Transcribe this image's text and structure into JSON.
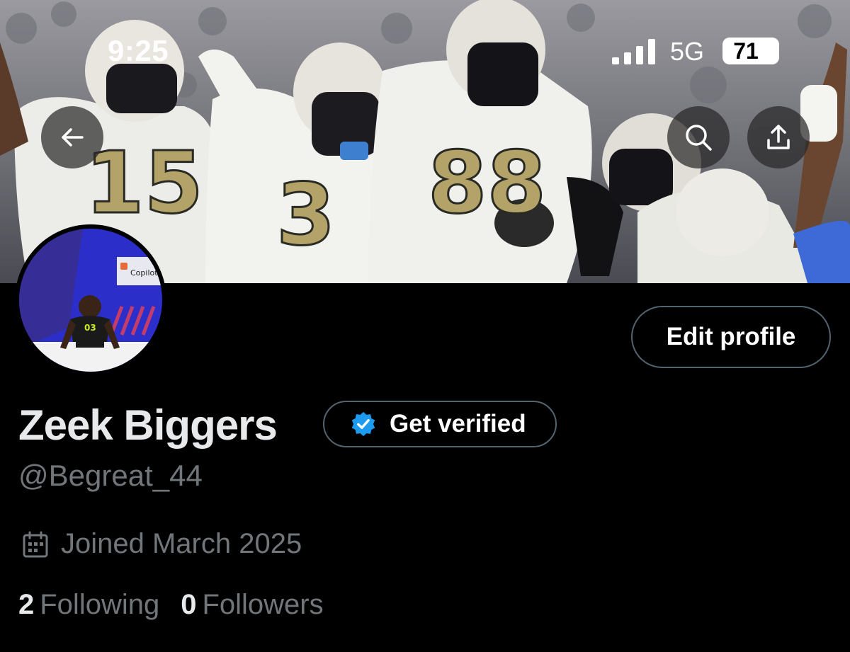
{
  "status_bar": {
    "time": "9:25",
    "network": "5G",
    "battery": "71"
  },
  "banner": {
    "jersey_numbers": [
      "15",
      "3",
      "88"
    ]
  },
  "header_actions": {
    "back_icon": "back-arrow-icon",
    "search_icon": "search-icon",
    "share_icon": "share-icon"
  },
  "avatar": {
    "jersey": "03",
    "sponsor_text": "Copilot"
  },
  "profile": {
    "edit_label": "Edit profile",
    "name": "Zeek Biggers",
    "get_verified_label": "Get verified",
    "handle": "@Begreat_44",
    "joined": "Joined March 2025",
    "following_count": "2",
    "following_label": "Following",
    "followers_count": "0",
    "followers_label": "Followers"
  },
  "colors": {
    "background": "#000000",
    "verified_blue": "#1d9bf0",
    "muted_text": "#71767b",
    "primary_text": "#e7e9ea",
    "border": "#536471",
    "jersey_gold": "#b3a369"
  }
}
